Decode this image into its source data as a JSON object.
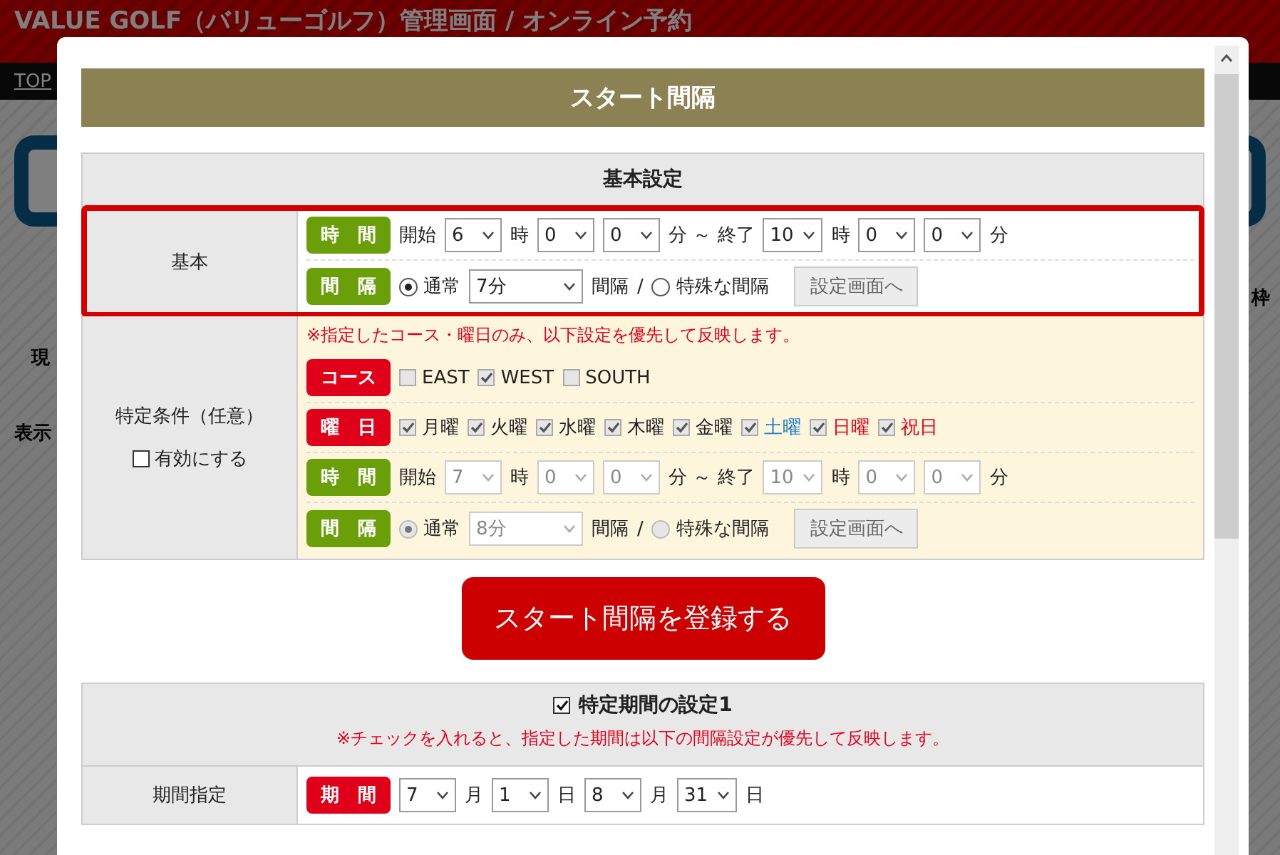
{
  "background": {
    "title": "VALUE GOLF（バリューゴルフ）管理画面 / オンライン予約",
    "nav_link": "TOP",
    "fragments": [
      {
        "text": "現"
      },
      {
        "text": "表示"
      },
      {
        "text": "枠"
      }
    ]
  },
  "modal": {
    "title": "スタート間隔",
    "settings": {
      "heading": "基本設定",
      "basic": {
        "label": "基本",
        "highlighted": true,
        "rows": [
          {
            "badge": {
              "text": "時　間",
              "color": "#6a9f0a"
            },
            "items": [
              {
                "kind": "text",
                "text": "開始"
              },
              {
                "kind": "select",
                "value": "6",
                "disabled": false
              },
              {
                "kind": "text",
                "text": "時"
              },
              {
                "kind": "select",
                "value": "0",
                "disabled": false
              },
              {
                "kind": "select",
                "value": "0",
                "disabled": false
              },
              {
                "kind": "text",
                "text": "分 ～ 終了"
              },
              {
                "kind": "select",
                "value": "10",
                "disabled": false
              },
              {
                "kind": "text",
                "text": "時"
              },
              {
                "kind": "select",
                "value": "0",
                "disabled": false
              },
              {
                "kind": "select",
                "value": "0",
                "disabled": false
              },
              {
                "kind": "text",
                "text": "分"
              }
            ]
          },
          {
            "badge": {
              "text": "間　隔",
              "color": "#6a9f0a"
            },
            "items": [
              {
                "kind": "radio",
                "text": "通常",
                "selected": true,
                "disabled": false
              },
              {
                "kind": "dropdown",
                "value": "7分",
                "disabled": false
              },
              {
                "kind": "text",
                "text": "間隔"
              },
              {
                "kind": "text",
                "text": "/"
              },
              {
                "kind": "radio",
                "text": "特殊な間隔",
                "selected": false,
                "disabled": false
              },
              {
                "kind": "button",
                "text": "設定画面へ"
              }
            ]
          }
        ]
      },
      "special": {
        "label": "特定条件（任意）",
        "enable": {
          "text": "有効にする",
          "checked": false
        },
        "note": "※指定したコース・曜日のみ、以下設定を優先して反映します。",
        "rows": [
          {
            "badge": {
              "text": "コース",
              "color": "#e0001a"
            },
            "items": [
              {
                "kind": "checkbox",
                "text": "EAST",
                "checked": false,
                "disabled": true
              },
              {
                "kind": "checkbox",
                "text": "WEST",
                "checked": true,
                "disabled": true
              },
              {
                "kind": "checkbox",
                "text": "SOUTH",
                "checked": false,
                "disabled": true
              }
            ]
          },
          {
            "badge": {
              "text": "曜　日",
              "color": "#e0001a"
            },
            "items": [
              {
                "kind": "checkbox",
                "text": "月曜",
                "checked": true,
                "disabled": true
              },
              {
                "kind": "checkbox",
                "text": "火曜",
                "checked": true,
                "disabled": true
              },
              {
                "kind": "checkbox",
                "text": "水曜",
                "checked": true,
                "disabled": true
              },
              {
                "kind": "checkbox",
                "text": "木曜",
                "checked": true,
                "disabled": true
              },
              {
                "kind": "checkbox",
                "text": "金曜",
                "checked": true,
                "disabled": true
              },
              {
                "kind": "checkbox",
                "text": "土曜",
                "checked": true,
                "disabled": true,
                "color": "#1a7ad0"
              },
              {
                "kind": "checkbox",
                "text": "日曜",
                "checked": true,
                "disabled": true,
                "color": "#e8001a"
              },
              {
                "kind": "checkbox",
                "text": "祝日",
                "checked": true,
                "disabled": true,
                "color": "#e8001a"
              }
            ]
          },
          {
            "badge": {
              "text": "時　間",
              "color": "#6a9f0a"
            },
            "items": [
              {
                "kind": "text",
                "text": "開始"
              },
              {
                "kind": "select",
                "value": "7",
                "disabled": true
              },
              {
                "kind": "text",
                "text": "時"
              },
              {
                "kind": "select",
                "value": "0",
                "disabled": true
              },
              {
                "kind": "select",
                "value": "0",
                "disabled": true
              },
              {
                "kind": "text",
                "text": "分 ～ 終了"
              },
              {
                "kind": "select",
                "value": "10",
                "disabled": true
              },
              {
                "kind": "text",
                "text": "時"
              },
              {
                "kind": "select",
                "value": "0",
                "disabled": true
              },
              {
                "kind": "select",
                "value": "0",
                "disabled": true
              },
              {
                "kind": "text",
                "text": "分"
              }
            ]
          },
          {
            "badge": {
              "text": "間　隔",
              "color": "#6a9f0a"
            },
            "items": [
              {
                "kind": "radio",
                "text": "通常",
                "selected": true,
                "disabled": true
              },
              {
                "kind": "dropdown",
                "value": "8分",
                "disabled": true
              },
              {
                "kind": "text",
                "text": "間隔"
              },
              {
                "kind": "text",
                "text": "/"
              },
              {
                "kind": "radio",
                "text": "特殊な間隔",
                "selected": false,
                "disabled": true
              },
              {
                "kind": "button",
                "text": "設定画面へ"
              }
            ]
          }
        ]
      }
    },
    "submit": "スタート間隔を登録する",
    "period": {
      "heading": "特定期間の設定1",
      "checked": true,
      "note": "※チェックを入れると、指定した期間は以下の間隔設定が優先して反映します。",
      "label": "期間指定",
      "row": {
        "badge": {
          "text": "期　間",
          "color": "#e0001a"
        },
        "items": [
          {
            "kind": "select",
            "value": "7",
            "disabled": false
          },
          {
            "kind": "text",
            "text": "月"
          },
          {
            "kind": "select",
            "value": "1",
            "disabled": false
          },
          {
            "kind": "text",
            "text": "日"
          },
          {
            "kind": "select",
            "value": "8",
            "disabled": false
          },
          {
            "kind": "text",
            "text": "月"
          },
          {
            "kind": "select",
            "value": "31",
            "disabled": false
          },
          {
            "kind": "text",
            "text": "日"
          }
        ]
      }
    }
  }
}
